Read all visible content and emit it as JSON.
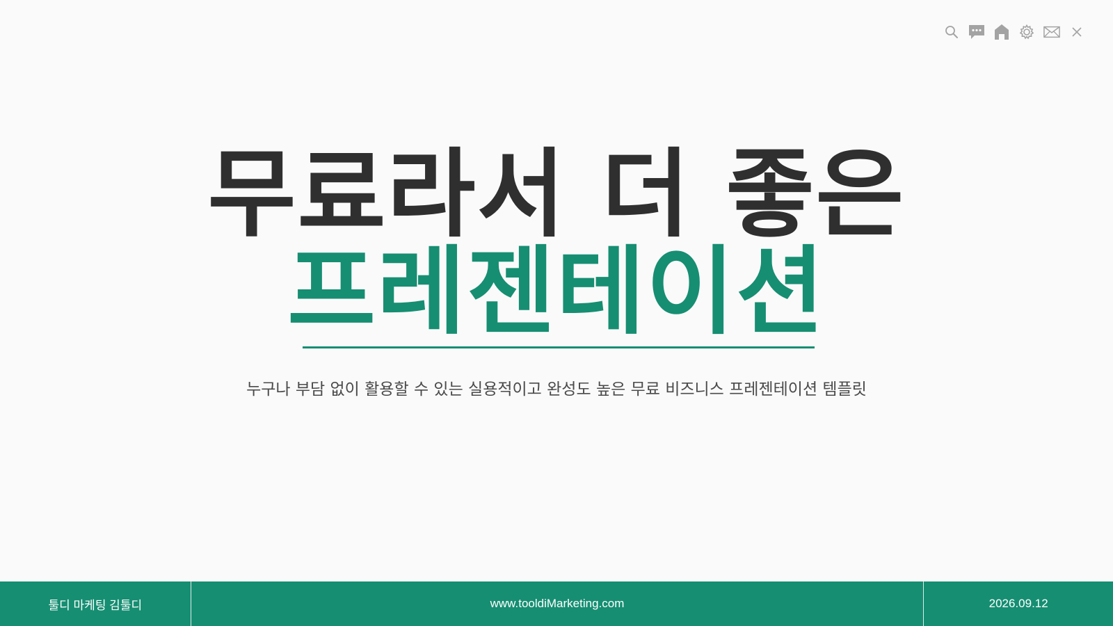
{
  "toolbar": {
    "icons": [
      "search-icon",
      "chat-icon",
      "home-icon",
      "gear-icon",
      "mail-icon",
      "close-icon"
    ],
    "icon_color": "#a3a3a3"
  },
  "title": {
    "line1": "무료라서 더 좋은",
    "line2": "프레젠테이션"
  },
  "subtitle": "누구나 부담 없이 활용할 수 있는 실용적이고 완성도 높은 무료 비즈니스 프레젠테이션 템플릿",
  "footer": {
    "author": "툴디 마케팅 김툴디",
    "website": "www.tooldiMarketing.com",
    "date": "2026.09.12"
  },
  "colors": {
    "accent": "#168e72",
    "title_dark": "#2f2f2f",
    "background": "#fafafa"
  }
}
